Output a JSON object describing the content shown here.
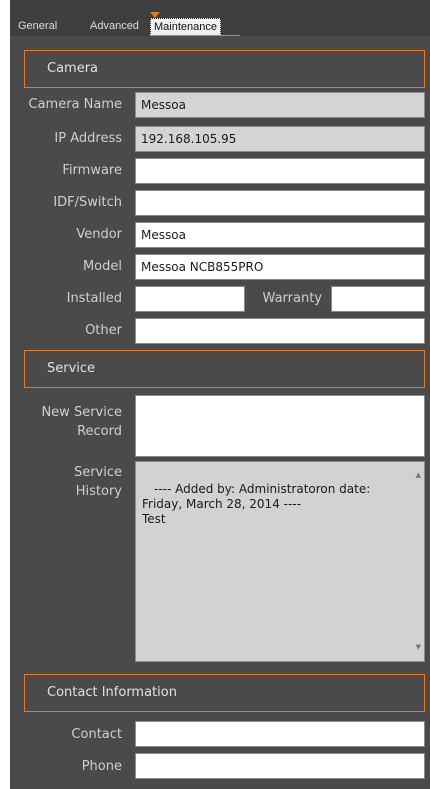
{
  "tabs": [
    {
      "label": "General"
    },
    {
      "label": "Advanced"
    },
    {
      "label": "Maintenance"
    }
  ],
  "sections": {
    "camera": "Camera",
    "service": "Service",
    "contact": "Contact Information"
  },
  "fields": {
    "camera_name": {
      "label": "Camera Name",
      "value": "Messoa"
    },
    "ip_address": {
      "label": "IP Address",
      "value": "192.168.105.95"
    },
    "firmware": {
      "label": "Firmware",
      "value": ""
    },
    "idf_switch": {
      "label": "IDF/Switch",
      "value": ""
    },
    "vendor": {
      "label": "Vendor",
      "value": "Messoa"
    },
    "model": {
      "label": "Model",
      "value": "Messoa NCB855PRO"
    },
    "installed": {
      "label": "Installed",
      "value": ""
    },
    "warranty": {
      "label": "Warranty",
      "value": ""
    },
    "other": {
      "label": "Other",
      "value": ""
    },
    "new_service_record": {
      "label_line1": "New Service",
      "label_line2": "Record",
      "value": ""
    },
    "service_history": {
      "label_line1": "Service",
      "label_line2": "History",
      "line1": "---- Added by: Administratoron date:",
      "line2": "Friday, March 28, 2014 ----",
      "line3": "Test"
    },
    "contact": {
      "label": "Contact",
      "value": ""
    },
    "phone": {
      "label": "Phone",
      "value": ""
    }
  },
  "icons": {
    "scroll_up": "triangle-up",
    "scroll_down": "triangle-down"
  },
  "colors": {
    "panel_bg": "#4a4a4a",
    "accent": "#e87722",
    "readonly_bg": "#d4d4d4"
  }
}
